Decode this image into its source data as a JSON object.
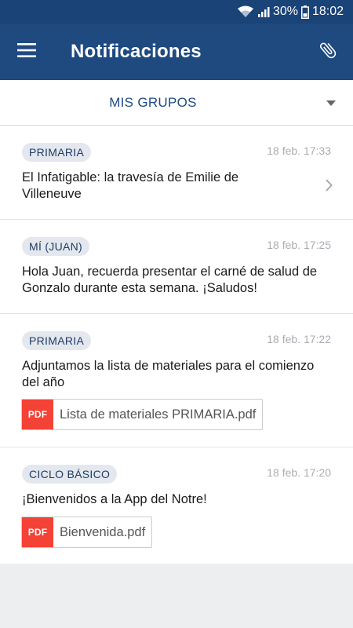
{
  "status_bar": {
    "battery": "30%",
    "time": "18:02"
  },
  "app_bar": {
    "title": "Notificaciones"
  },
  "group_selector": {
    "label": "MIS GRUPOS"
  },
  "notifications": [
    {
      "tag": "PRIMARIA",
      "time": "18 feb. 17:33",
      "message": "El Infatigable: la travesía de Emilie de Villeneuve"
    },
    {
      "tag": "MÍ (JUAN)",
      "time": "18 feb. 17:25",
      "message": "Hola Juan, recuerda presentar el carné de salud de Gonzalo durante esta semana. ¡Saludos!"
    },
    {
      "tag": "PRIMARIA",
      "time": "18 feb. 17:22",
      "message": "Adjuntamos la lista de materiales para el comienzo del año",
      "attachment": {
        "type": "PDF",
        "name": "Lista de materiales PRIMARIA.pdf"
      }
    },
    {
      "tag": "CICLO BÁSICO",
      "time": "18 feb. 17:20",
      "message": "¡Bienvenidos a la App del Notre!",
      "attachment": {
        "type": "PDF",
        "name": "Bienvenida.pdf"
      }
    }
  ],
  "colors": {
    "app_bar": "#1e4a80",
    "status_bar": "#1a4378",
    "pdf": "#f44236",
    "accent_text": "#1e4a80"
  }
}
